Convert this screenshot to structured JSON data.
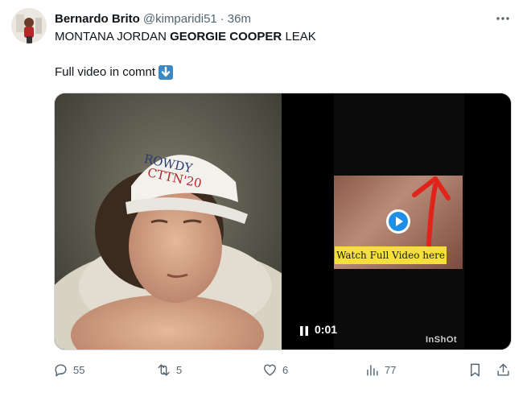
{
  "author": {
    "display_name": "Bernardo Brito",
    "handle": "@kimparidi51",
    "separator": "·",
    "time": "36m"
  },
  "tweet": {
    "line1_part1": "MONTANA JORDAN ",
    "line1_bold": "GEORGIE COOPER",
    "line1_part2": " LEAK",
    "line2": "Full video in comnt"
  },
  "media": {
    "left_photo_cap_text_1": "ROWDY",
    "left_photo_cap_text_2": "CTTN'20",
    "watch_banner": "Watch Full Video here",
    "video_time": "0:01",
    "watermark": "InShOt"
  },
  "actions": {
    "replies": "55",
    "reposts": "5",
    "likes": "6",
    "views": "77"
  },
  "icons": {
    "more": "more-icon",
    "reply": "reply-icon",
    "repost": "repost-icon",
    "like": "heart-icon",
    "views": "bar-chart-icon",
    "bookmark": "bookmark-icon",
    "share": "share-icon",
    "down_arrow_emoji": "down-arrow-emoji-icon",
    "play": "play-icon",
    "pause": "pause-icon"
  },
  "colors": {
    "text_primary": "#0f1419",
    "text_secondary": "#536471",
    "banner_yellow": "#f5e03b",
    "play_blue": "#1d8fe6",
    "arrow_red": "#e0241b"
  }
}
